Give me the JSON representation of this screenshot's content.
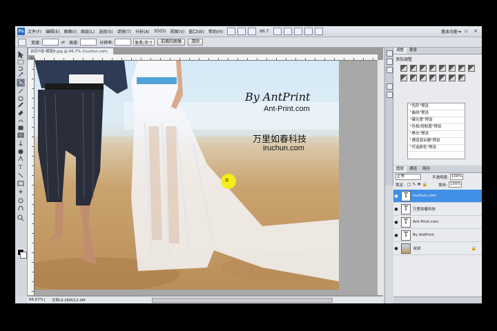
{
  "menubar": {
    "logo": "Ps",
    "items": [
      "文件(F)",
      "编辑(E)",
      "图像(I)",
      "图层(L)",
      "选择(S)",
      "滤镜(T)",
      "分析(A)",
      "3D(D)",
      "视图(V)",
      "窗口(W)",
      "帮助(H)"
    ],
    "zoom": "66.7",
    "workspace": "基本功能 ▾",
    "window_buttons": "– ▫ ×"
  },
  "options": {
    "width_label": "宽度:",
    "height_label": "高度:",
    "resolution_label": "分辨率:",
    "unit_select": "像素/英寸",
    "front_image_button": "前面的图像",
    "clear_button": "清除"
  },
  "document": {
    "tab_title": "台历7组-横版8.jpg @ 66.7% (iruchun.com, RGB/8)",
    "photo_text": {
      "by_antprint": "By AntPrint",
      "antprint_url": "Ant-Print.com",
      "company_cn": "万里如春科技",
      "company_url": "iruchun.com"
    },
    "status_zoom": "66.67%",
    "status_doc": "文档:9.26M/12.0M"
  },
  "adjustments": {
    "tabs": [
      "调整",
      "蒙版"
    ],
    "title": "添加调整",
    "presets": [
      "\"色阶\"预设",
      "\"曲线\"预设",
      "\"曝光度\"预设",
      "\"色相/饱和度\"预设",
      "\"黑白\"预设",
      "\"通道混合器\"预设",
      "\"可选颜色\"预设"
    ]
  },
  "layers_panel": {
    "tabs": [
      "图层",
      "通道",
      "路径"
    ],
    "blend_mode": "正常",
    "opacity_label": "不透明度:",
    "opacity": "100%",
    "lock_label": "锁定:",
    "fill_label": "填充:",
    "fill": "100%",
    "layers": [
      {
        "name": "iruchun.com",
        "type": "text",
        "selected": true
      },
      {
        "name": "万里如春科技",
        "type": "text",
        "selected": false
      },
      {
        "name": "Ant-Print.com",
        "type": "text",
        "selected": false
      },
      {
        "name": "By AntPrint",
        "type": "text",
        "selected": false
      },
      {
        "name": "背景",
        "type": "image",
        "selected": false
      }
    ]
  },
  "colors": {
    "selected_layer": "#3f90e6",
    "cursor_highlight": "#f5f016",
    "ps_blue": "#2c6fb6"
  }
}
